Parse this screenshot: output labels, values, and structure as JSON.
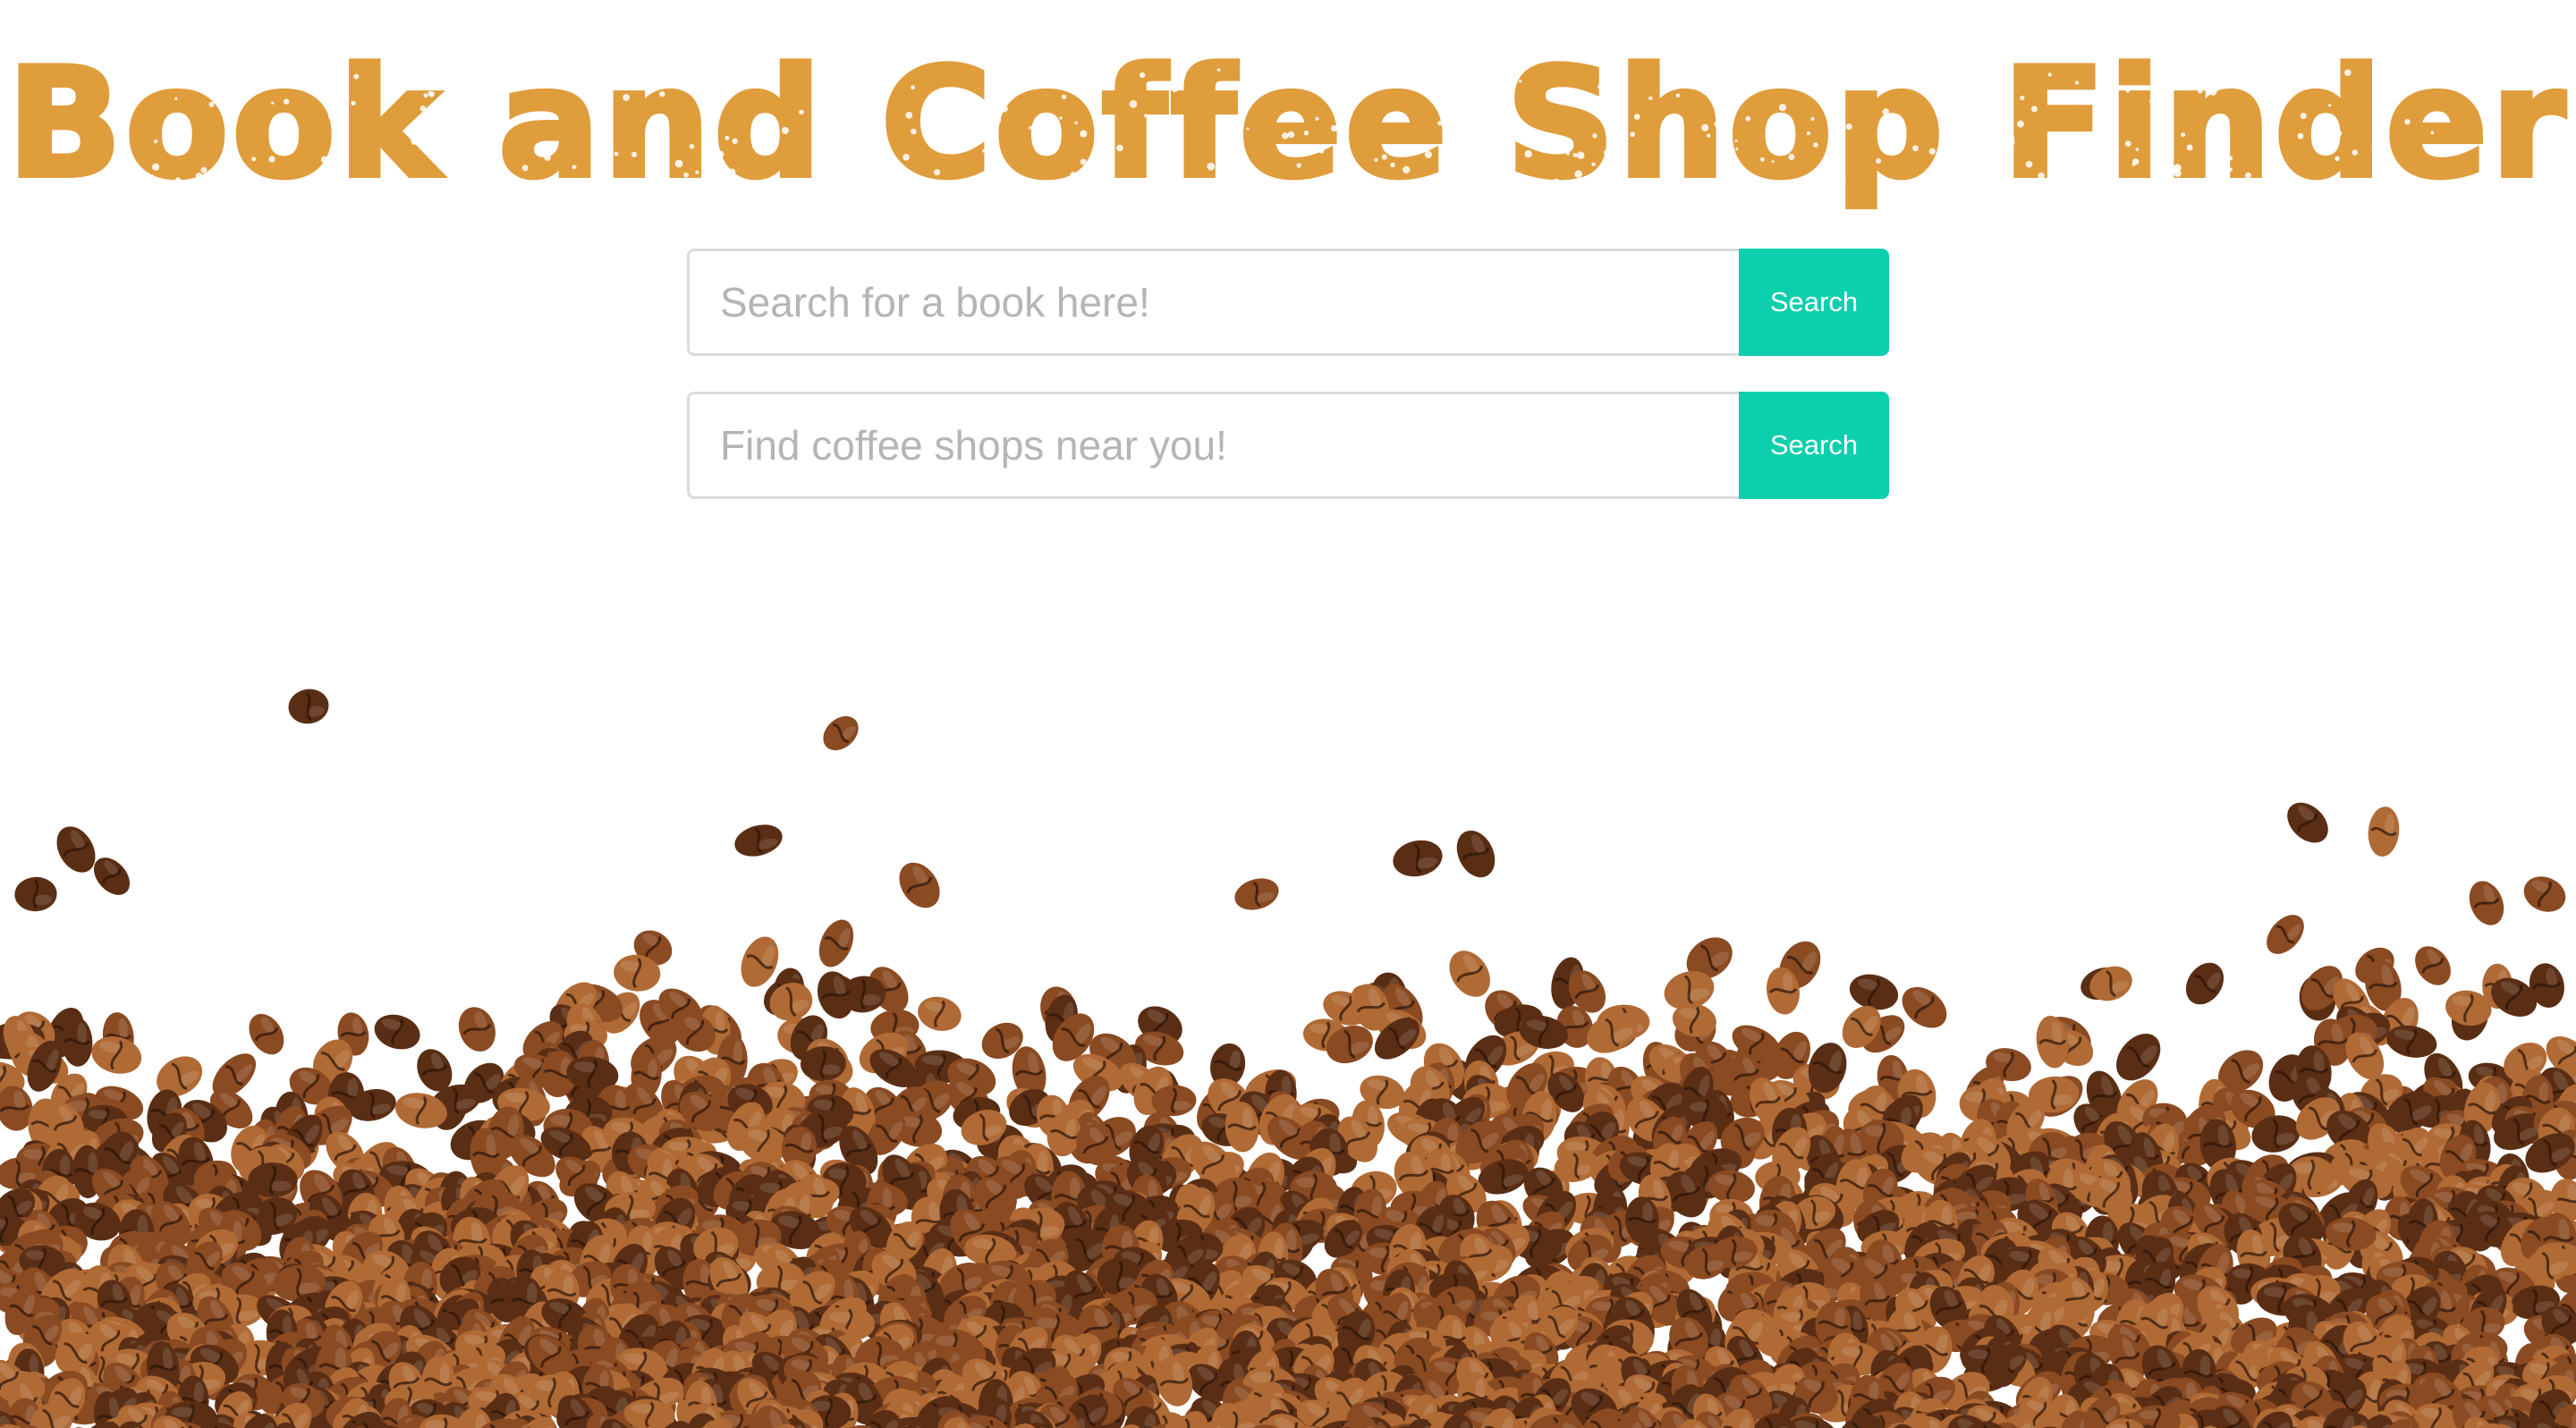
{
  "colors": {
    "title": "#e09d3c",
    "button": "#0ccfad",
    "bean_dark": "#5a2e14",
    "bean_mid": "#8a4a22",
    "bean_light": "#b06a35"
  },
  "header": {
    "title": "Book and Coffee Shop Finder"
  },
  "book_search": {
    "value": "",
    "placeholder": "Search for a book here!",
    "button_label": "Search"
  },
  "coffee_search": {
    "value": "",
    "placeholder": "Find coffee shops near you!",
    "button_label": "Search"
  },
  "background": {
    "image": "coffee-beans-photo"
  }
}
